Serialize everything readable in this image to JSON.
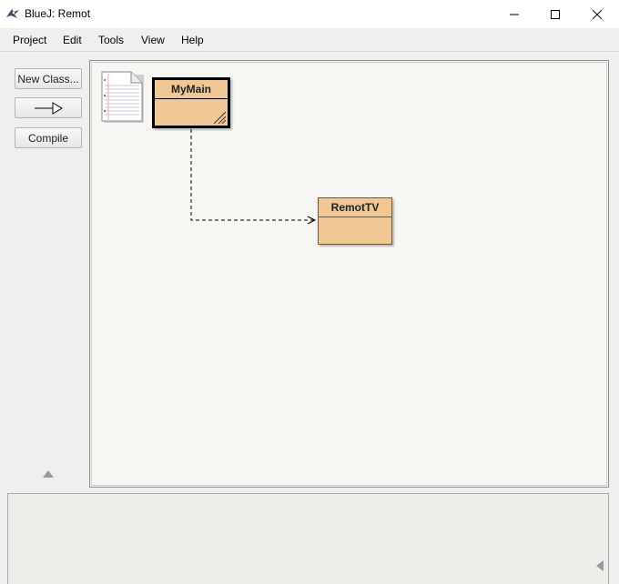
{
  "window": {
    "title": "BlueJ:  Remot"
  },
  "menubar": {
    "items": [
      "Project",
      "Edit",
      "Tools",
      "View",
      "Help"
    ]
  },
  "toolbar": {
    "new_class_label": "New Class...",
    "compile_label": "Compile"
  },
  "diagram": {
    "classes": [
      {
        "name": "MyMain",
        "selected": true,
        "needs_compile": true
      },
      {
        "name": "RemotTV",
        "selected": false,
        "needs_compile": false
      }
    ],
    "dependency": {
      "from": "MyMain",
      "to": "RemotTV"
    }
  },
  "colors": {
    "class_fill": "#f1c894",
    "canvas_bg": "#f7f6f2",
    "window_bg": "#efefef"
  }
}
